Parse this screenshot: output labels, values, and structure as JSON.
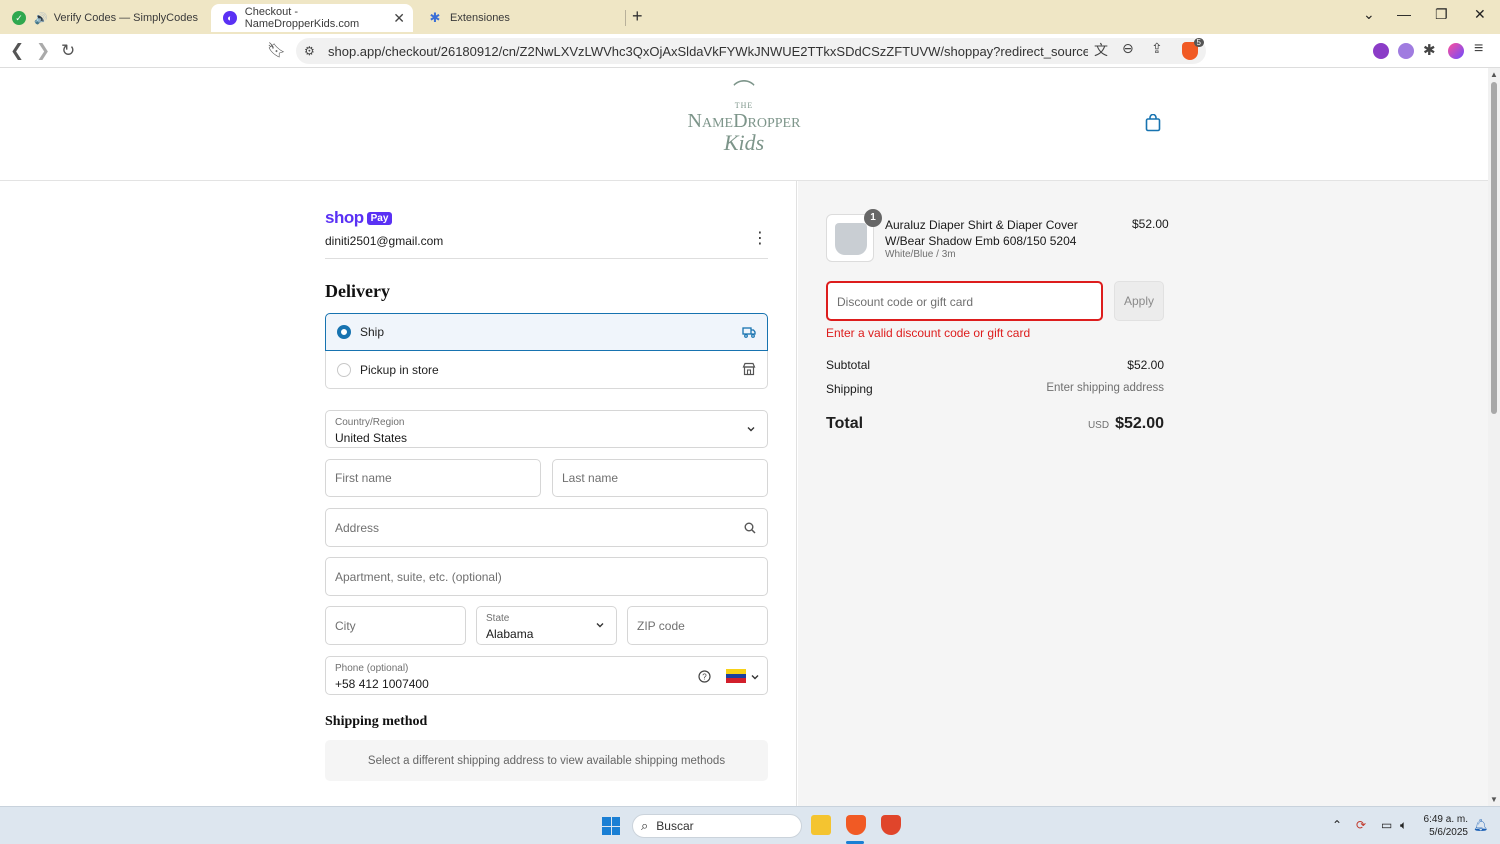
{
  "browser": {
    "tabs": [
      {
        "title": "Verify Codes — SimplyCodes",
        "active": false
      },
      {
        "title": "Checkout - NameDropperKids.com",
        "active": true
      },
      {
        "title": "Extensiones",
        "active": false
      }
    ],
    "url": "shop.app/checkout/26180912/cn/Z2NwLXVzLWVhc3QxOjAxSldaVkFYWkJNWUE2TTkxSDdCSzZFTUVW/shoppay?redirect_source=checkout_univ...",
    "brave_badge": "5"
  },
  "site": {
    "logo": {
      "the": "THE",
      "name": "NameDropper",
      "kids": "Kids"
    }
  },
  "left": {
    "shoppay": {
      "shop": "shop",
      "pay": "Pay"
    },
    "email": "diniti2501@gmail.com",
    "delivery_heading": "Delivery",
    "ship_label": "Ship",
    "pickup_label": "Pickup in store",
    "country": {
      "label": "Country/Region",
      "value": "United States"
    },
    "first_name_placeholder": "First name",
    "last_name_placeholder": "Last name",
    "address_placeholder": "Address",
    "apartment_placeholder": "Apartment, suite, etc. (optional)",
    "city_placeholder": "City",
    "state": {
      "label": "State",
      "value": "Alabama"
    },
    "zip_placeholder": "ZIP code",
    "phone": {
      "label": "Phone (optional)",
      "value": "+58 412 1007400"
    },
    "shipping_method_heading": "Shipping method",
    "shipping_note": "Select a different shipping address to view available shipping methods"
  },
  "right": {
    "product": {
      "qty": "1",
      "name": "Auraluz Diaper Shirt & Diaper Cover W/Bear Shadow Emb 608/150 5204",
      "variant": "White/Blue / 3m",
      "price": "$52.00"
    },
    "discount_placeholder": "Discount code or gift card",
    "apply_label": "Apply",
    "error": "Enter a valid discount code or gift card",
    "subtotal_label": "Subtotal",
    "subtotal_value": "$52.00",
    "shipping_label": "Shipping",
    "shipping_value": "Enter shipping address",
    "total_label": "Total",
    "total_currency": "USD",
    "total_value": "$52.00"
  },
  "taskbar": {
    "search_placeholder": "Buscar",
    "time": "6:49 a. m.",
    "date": "5/6/2025"
  },
  "colors": {
    "accent": "#1773b0",
    "error": "#dd1d1d",
    "shop_purple": "#5a31f4",
    "tabbar": "#efe6c5"
  }
}
